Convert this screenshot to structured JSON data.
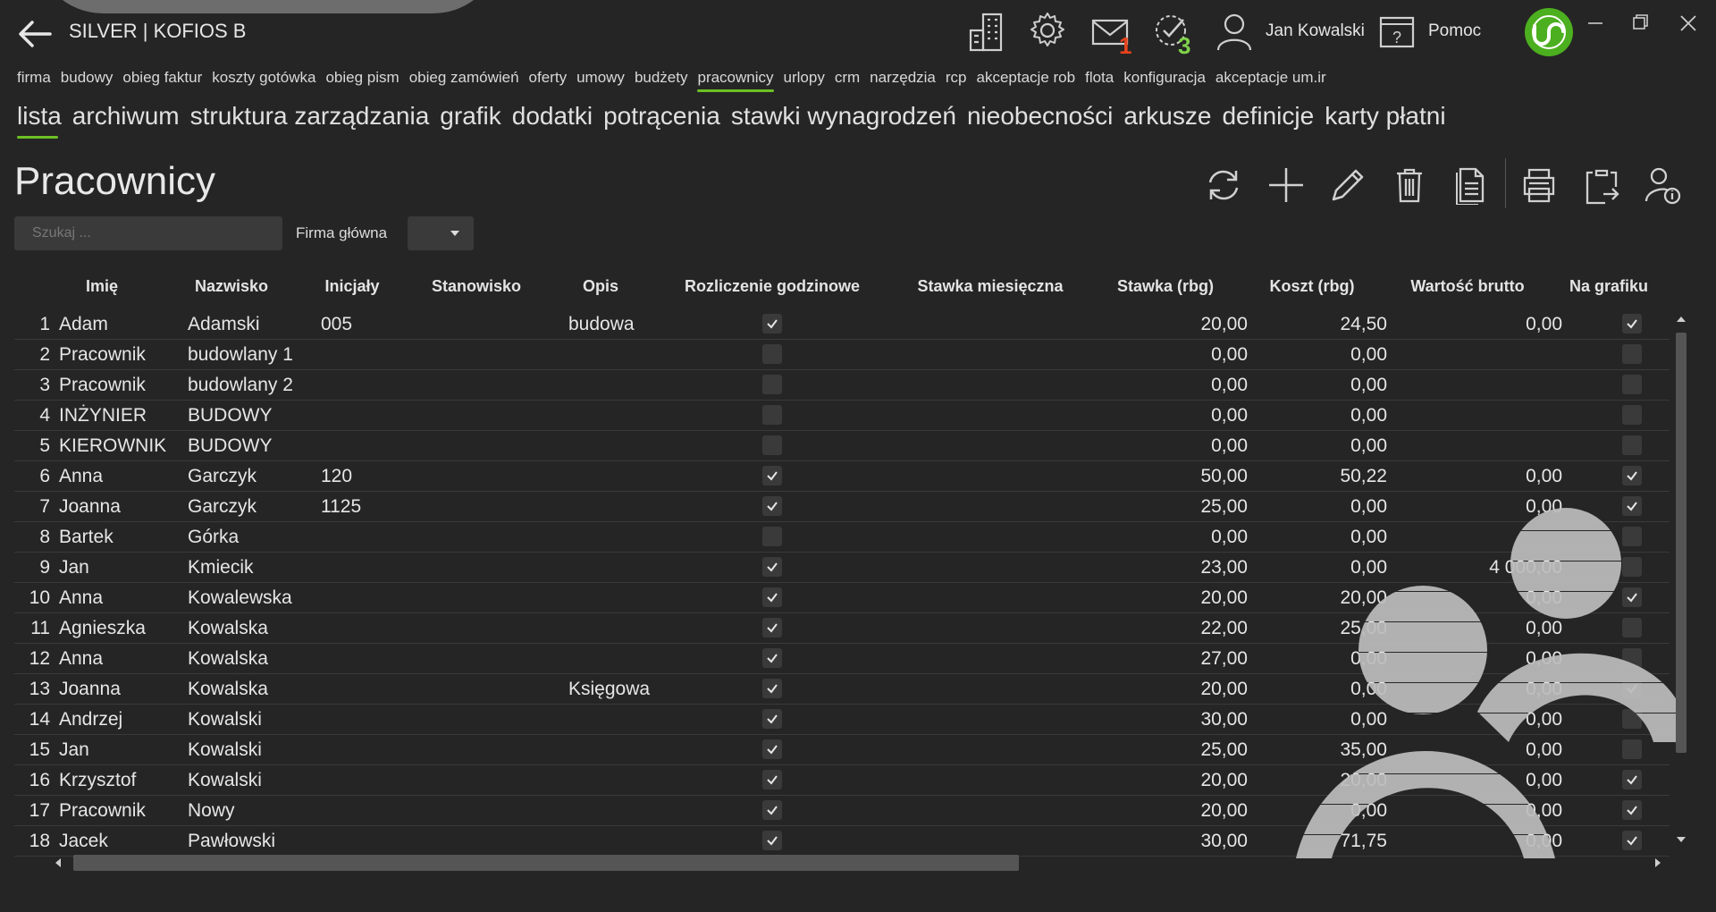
{
  "app": {
    "title": "SILVER | KOFIOS B"
  },
  "titlebar": {
    "mail_badge": "1",
    "tasks_badge": "3",
    "user_name": "Jan Kowalski",
    "help_label": "Pomoc",
    "colors": {
      "mail_badge": "#e8431c",
      "tasks_badge": "#7fd14a",
      "accent": "#6cc024",
      "logo": "#4caf1f"
    }
  },
  "menu_primary": [
    {
      "label": "firma"
    },
    {
      "label": "budowy"
    },
    {
      "label": "obieg faktur"
    },
    {
      "label": "koszty gotówka"
    },
    {
      "label": "obieg pism"
    },
    {
      "label": "obieg zamówień"
    },
    {
      "label": "oferty"
    },
    {
      "label": "umowy"
    },
    {
      "label": "budżety"
    },
    {
      "label": "pracownicy"
    },
    {
      "label": "urlopy"
    },
    {
      "label": "crm"
    },
    {
      "label": "narzędzia"
    },
    {
      "label": "rcp"
    },
    {
      "label": "akceptacje rob"
    },
    {
      "label": "flota"
    },
    {
      "label": "konfiguracja"
    },
    {
      "label": "akceptacje um.ir"
    }
  ],
  "menu_primary_active": "pracownicy",
  "menu_secondary": [
    {
      "label": "lista"
    },
    {
      "label": "archiwum"
    },
    {
      "label": "struktura zarządzania"
    },
    {
      "label": "grafik"
    },
    {
      "label": "dodatki"
    },
    {
      "label": "potrącenia"
    },
    {
      "label": "stawki wynagrodzeń"
    },
    {
      "label": "nieobecności"
    },
    {
      "label": "arkusze"
    },
    {
      "label": "definicje"
    },
    {
      "label": "karty płatni"
    }
  ],
  "menu_secondary_active": "lista",
  "page": {
    "title": "Pracownicy"
  },
  "filters": {
    "search_placeholder": "Szukaj ...",
    "firma_label": "Firma główna",
    "firma_value": ""
  },
  "toolbar_icons": [
    "refresh-icon",
    "add-icon",
    "edit-icon",
    "delete-icon",
    "document-icon",
    "print-icon",
    "clipboard-export-icon",
    "user-info-icon"
  ],
  "table": {
    "columns": [
      "Imię",
      "Nazwisko",
      "Inicjały",
      "Stanowisko",
      "Opis",
      "Rozliczenie godzinowe",
      "Stawka miesięczna",
      "Stawka (rbg)",
      "Koszt (rbg)",
      "Wartość brutto",
      "Na grafiku"
    ],
    "rows": [
      {
        "n": "1",
        "imie": "Adam",
        "nazwisko": "Adamski",
        "inicjaly": "005",
        "stanowisko": "",
        "opis": "budowa",
        "rozliczenie": true,
        "stawka_mies": "",
        "stawka_rbg": "20,00",
        "koszt": "24,50",
        "brutto": "0,00",
        "grafik": true
      },
      {
        "n": "2",
        "imie": "Pracownik",
        "nazwisko": "budowlany 1",
        "inicjaly": "",
        "stanowisko": "",
        "opis": "",
        "rozliczenie": false,
        "stawka_mies": "",
        "stawka_rbg": "0,00",
        "koszt": "0,00",
        "brutto": "",
        "grafik": false
      },
      {
        "n": "3",
        "imie": "Pracownik",
        "nazwisko": "budowlany 2",
        "inicjaly": "",
        "stanowisko": "",
        "opis": "",
        "rozliczenie": false,
        "stawka_mies": "",
        "stawka_rbg": "0,00",
        "koszt": "0,00",
        "brutto": "",
        "grafik": false
      },
      {
        "n": "4",
        "imie": "INŻYNIER",
        "nazwisko": "BUDOWY",
        "inicjaly": "",
        "stanowisko": "",
        "opis": "",
        "rozliczenie": false,
        "stawka_mies": "",
        "stawka_rbg": "0,00",
        "koszt": "0,00",
        "brutto": "",
        "grafik": false
      },
      {
        "n": "5",
        "imie": "KIEROWNIK",
        "nazwisko": "BUDOWY",
        "inicjaly": "",
        "stanowisko": "",
        "opis": "",
        "rozliczenie": false,
        "stawka_mies": "",
        "stawka_rbg": "0,00",
        "koszt": "0,00",
        "brutto": "",
        "grafik": false
      },
      {
        "n": "6",
        "imie": "Anna",
        "nazwisko": "Garczyk",
        "inicjaly": "120",
        "stanowisko": "",
        "opis": "",
        "rozliczenie": true,
        "stawka_mies": "",
        "stawka_rbg": "50,00",
        "koszt": "50,22",
        "brutto": "0,00",
        "grafik": true
      },
      {
        "n": "7",
        "imie": "Joanna",
        "nazwisko": "Garczyk",
        "inicjaly": "1125",
        "stanowisko": "",
        "opis": "",
        "rozliczenie": true,
        "stawka_mies": "",
        "stawka_rbg": "25,00",
        "koszt": "0,00",
        "brutto": "0,00",
        "grafik": true
      },
      {
        "n": "8",
        "imie": "Bartek",
        "nazwisko": "Górka",
        "inicjaly": "",
        "stanowisko": "",
        "opis": "",
        "rozliczenie": false,
        "stawka_mies": "",
        "stawka_rbg": "0,00",
        "koszt": "0,00",
        "brutto": "",
        "grafik": false
      },
      {
        "n": "9",
        "imie": "Jan",
        "nazwisko": "Kmiecik",
        "inicjaly": "",
        "stanowisko": "",
        "opis": "",
        "rozliczenie": true,
        "stawka_mies": "",
        "stawka_rbg": "23,00",
        "koszt": "0,00",
        "brutto": "4 000,00",
        "grafik": false
      },
      {
        "n": "10",
        "imie": "Anna",
        "nazwisko": "Kowalewska",
        "inicjaly": "",
        "stanowisko": "",
        "opis": "",
        "rozliczenie": true,
        "stawka_mies": "",
        "stawka_rbg": "20,00",
        "koszt": "20,00",
        "brutto": "0,00",
        "grafik": true
      },
      {
        "n": "11",
        "imie": "Agnieszka",
        "nazwisko": "Kowalska",
        "inicjaly": "",
        "stanowisko": "",
        "opis": "",
        "rozliczenie": true,
        "stawka_mies": "",
        "stawka_rbg": "22,00",
        "koszt": "25,00",
        "brutto": "0,00",
        "grafik": false
      },
      {
        "n": "12",
        "imie": "Anna",
        "nazwisko": "Kowalska",
        "inicjaly": "",
        "stanowisko": "",
        "opis": "",
        "rozliczenie": true,
        "stawka_mies": "",
        "stawka_rbg": "27,00",
        "koszt": "0,00",
        "brutto": "0,00",
        "grafik": false
      },
      {
        "n": "13",
        "imie": "Joanna",
        "nazwisko": "Kowalska",
        "inicjaly": "",
        "stanowisko": "",
        "opis": "Księgowa",
        "rozliczenie": true,
        "stawka_mies": "",
        "stawka_rbg": "20,00",
        "koszt": "0,00",
        "brutto": "0,00",
        "grafik": true
      },
      {
        "n": "14",
        "imie": "Andrzej",
        "nazwisko": "Kowalski",
        "inicjaly": "",
        "stanowisko": "",
        "opis": "",
        "rozliczenie": true,
        "stawka_mies": "",
        "stawka_rbg": "30,00",
        "koszt": "0,00",
        "brutto": "0,00",
        "grafik": false
      },
      {
        "n": "15",
        "imie": "Jan",
        "nazwisko": "Kowalski",
        "inicjaly": "",
        "stanowisko": "",
        "opis": "",
        "rozliczenie": true,
        "stawka_mies": "",
        "stawka_rbg": "25,00",
        "koszt": "35,00",
        "brutto": "0,00",
        "grafik": false
      },
      {
        "n": "16",
        "imie": "Krzysztof",
        "nazwisko": "Kowalski",
        "inicjaly": "",
        "stanowisko": "",
        "opis": "",
        "rozliczenie": true,
        "stawka_mies": "",
        "stawka_rbg": "20,00",
        "koszt": "20,00",
        "brutto": "0,00",
        "grafik": true
      },
      {
        "n": "17",
        "imie": "Pracownik",
        "nazwisko": "Nowy",
        "inicjaly": "",
        "stanowisko": "",
        "opis": "",
        "rozliczenie": true,
        "stawka_mies": "",
        "stawka_rbg": "20,00",
        "koszt": "0,00",
        "brutto": "0,00",
        "grafik": true
      },
      {
        "n": "18",
        "imie": "Jacek",
        "nazwisko": "Pawłowski",
        "inicjaly": "",
        "stanowisko": "",
        "opis": "",
        "rozliczenie": true,
        "stawka_mies": "",
        "stawka_rbg": "30,00",
        "koszt": "71,75",
        "brutto": "0,00",
        "grafik": true
      }
    ]
  }
}
